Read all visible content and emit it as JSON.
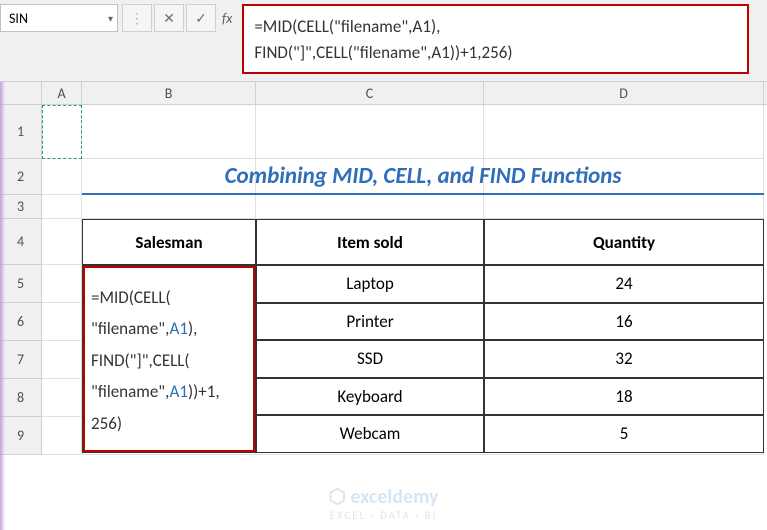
{
  "nameBox": {
    "value": "SIN"
  },
  "formulaBar": {
    "line1": "=MID(CELL(\"filename\",A1),",
    "line2": "FIND(\"]\",CELL(\"filename\",A1))+1,256)"
  },
  "fxLabel": "fx",
  "columns": [
    "A",
    "B",
    "C",
    "D"
  ],
  "rows": [
    "1",
    "2",
    "3",
    "4",
    "5",
    "6",
    "7",
    "8",
    "9"
  ],
  "title": "Combining MID, CELL, and FIND Functions",
  "table": {
    "headers": {
      "salesman": "Salesman",
      "itemSold": "Item sold",
      "quantity": "Quantity"
    },
    "data": [
      {
        "item": "Laptop",
        "qty": "24"
      },
      {
        "item": "Printer",
        "qty": "16"
      },
      {
        "item": "SSD",
        "qty": "32"
      },
      {
        "item": "Keyboard",
        "qty": "18"
      },
      {
        "item": "Webcam",
        "qty": "5"
      }
    ]
  },
  "formulaOverlay": {
    "l1_a": "=MID(CELL(",
    "l2_a": "\"filename\",",
    "l2_ref": "A1",
    "l2_b": "),",
    "l3_a": "FIND(\"]\",CELL(",
    "l4_a": "\"filename\",",
    "l4_ref": "A1",
    "l4_b": "))+1,",
    "l5_a": "256)"
  },
  "watermark": {
    "brand": "exceldemy",
    "sub": "EXCEL · DATA · BI",
    "icon": "⬡"
  }
}
